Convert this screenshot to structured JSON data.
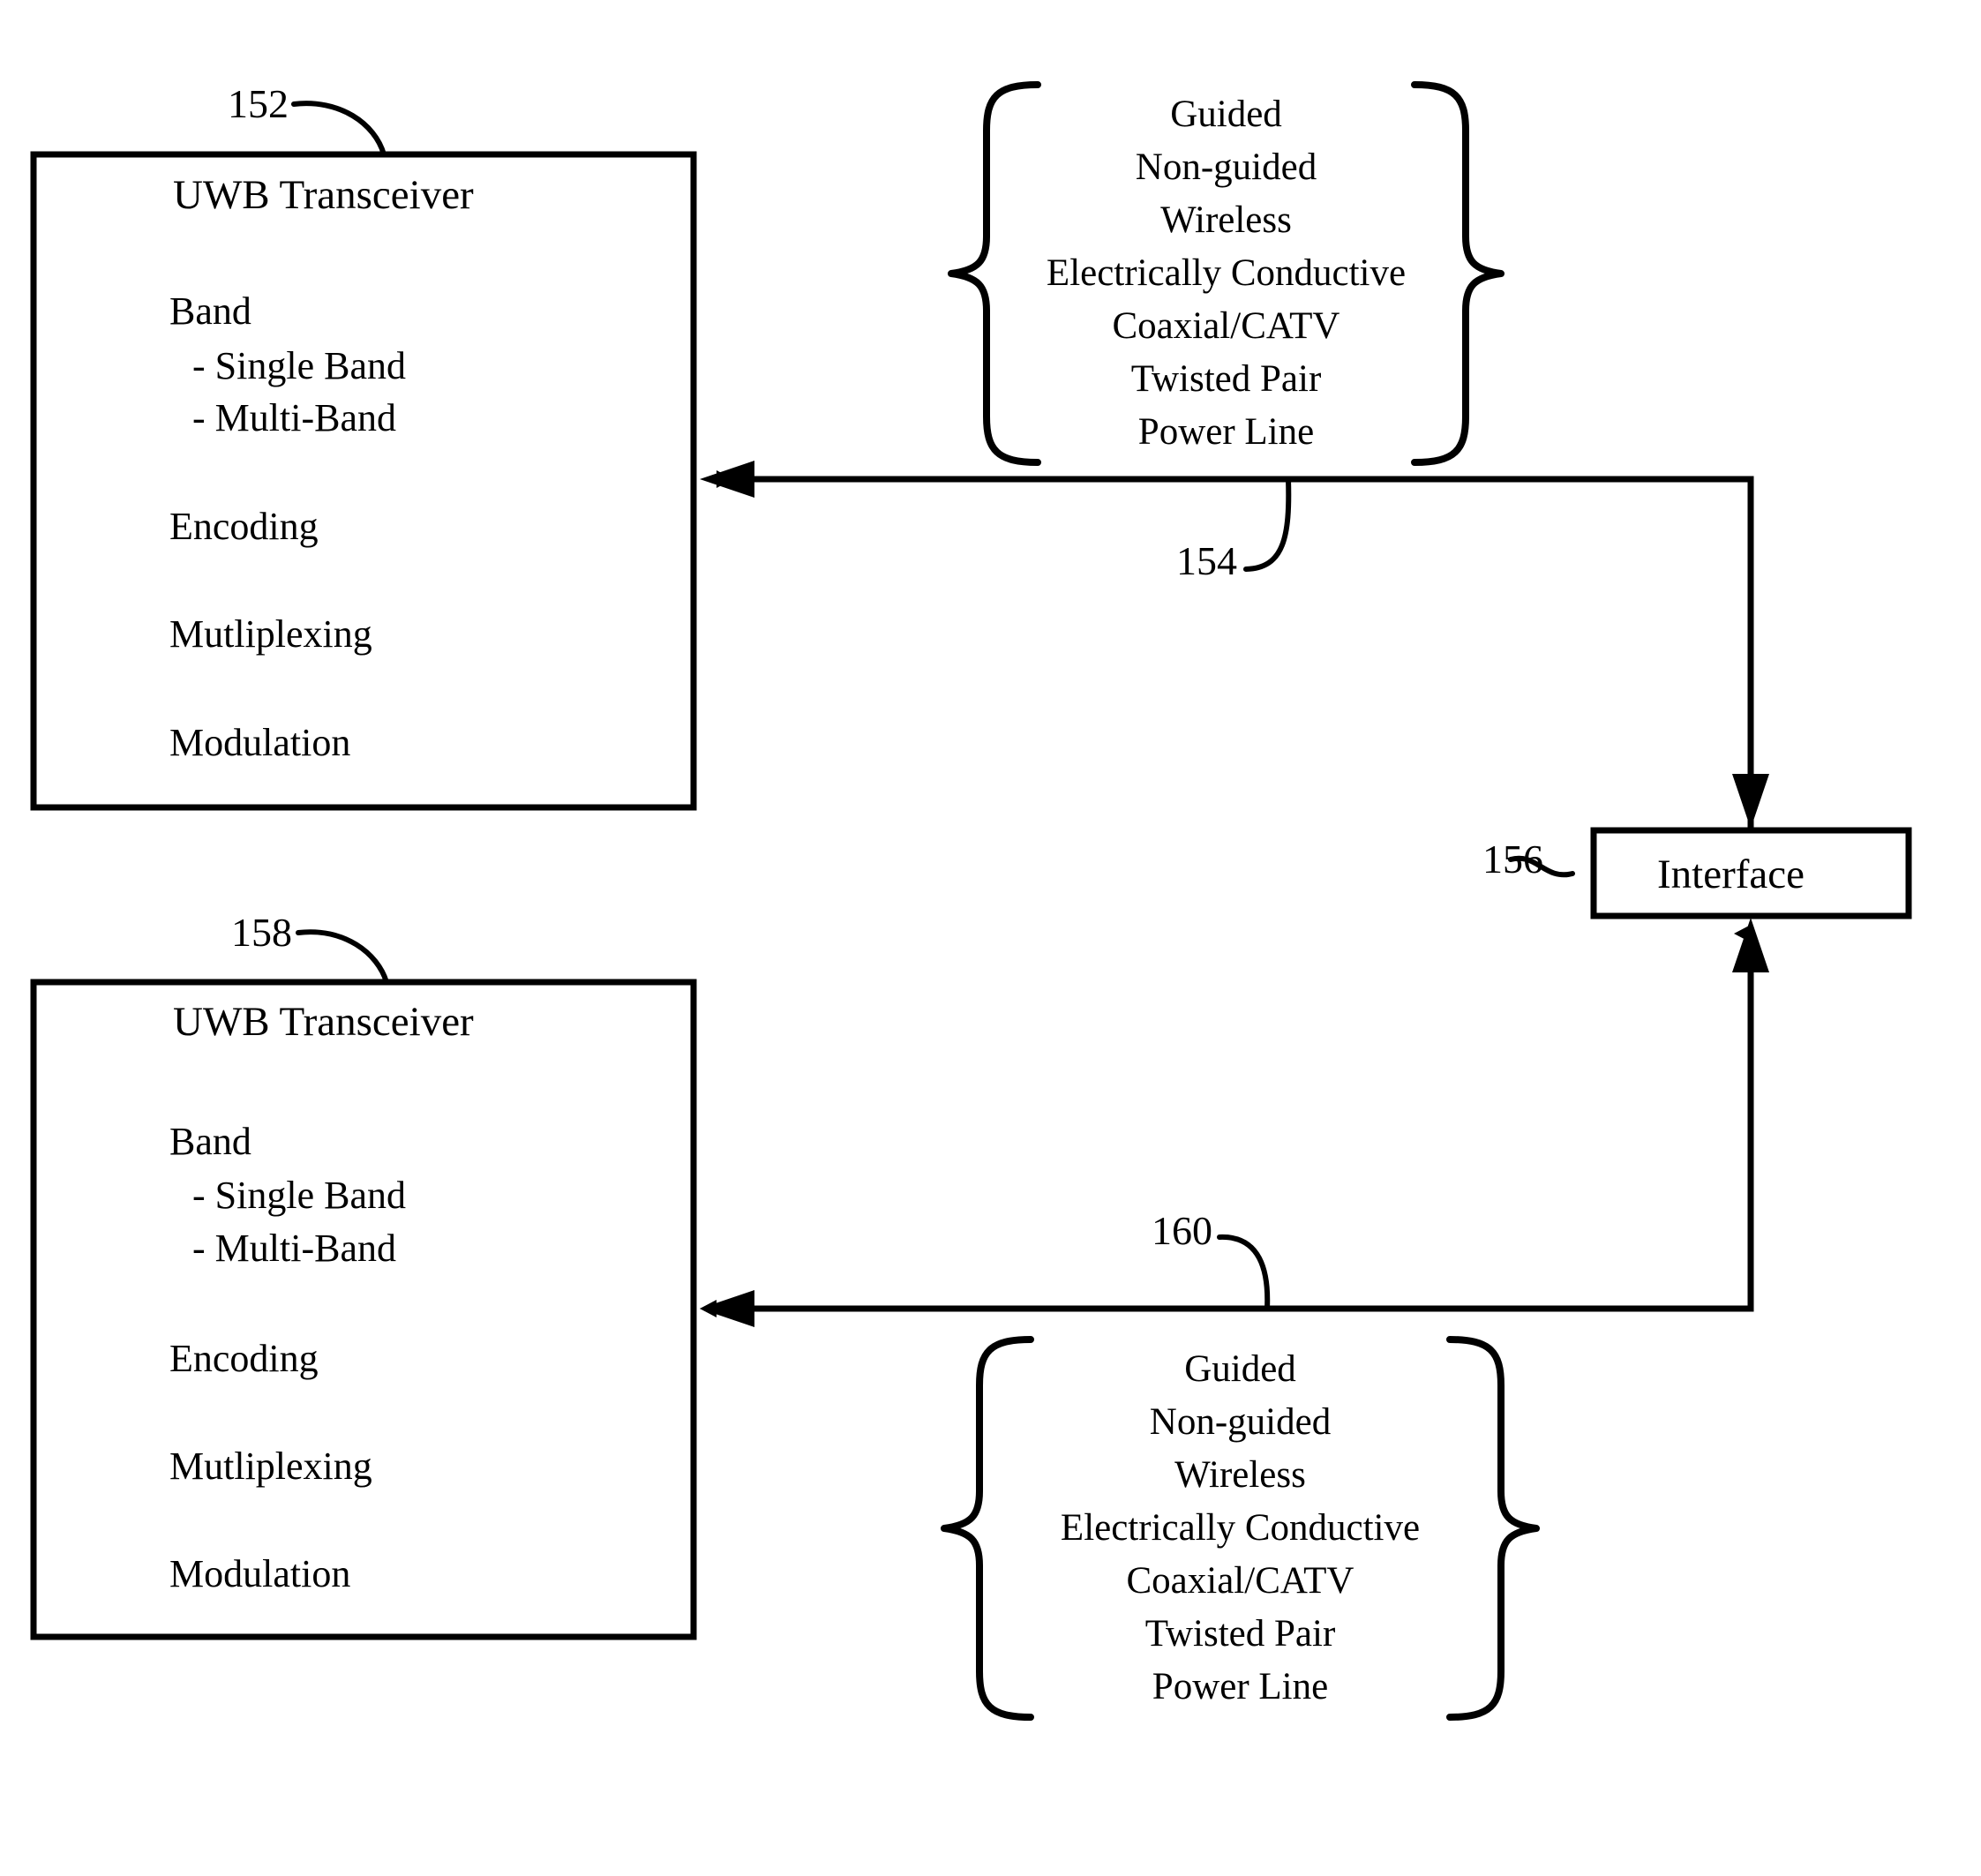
{
  "figure": {
    "background_color": "#ffffff",
    "stroke_color": "#000000"
  },
  "transceiver_top": {
    "ref": "152",
    "title": "UWB Transceiver",
    "items": [
      {
        "label": "Band",
        "subitems": [
          "- Single Band",
          "- Multi-Band"
        ]
      },
      {
        "label": "Encoding",
        "subitems": []
      },
      {
        "label": "Mutliplexing",
        "subitems": []
      },
      {
        "label": "Modulation",
        "subitems": []
      }
    ]
  },
  "transceiver_bottom": {
    "ref": "158",
    "title": "UWB Transceiver",
    "items": [
      {
        "label": "Band",
        "subitems": [
          "- Single Band",
          "- Multi-Band"
        ]
      },
      {
        "label": "Encoding",
        "subitems": []
      },
      {
        "label": "Mutliplexing",
        "subitems": []
      },
      {
        "label": "Modulation",
        "subitems": []
      }
    ]
  },
  "interface": {
    "ref": "156",
    "label": "Interface"
  },
  "link_top": {
    "ref": "154",
    "media_types": [
      "Guided",
      "Non-guided",
      "Wireless",
      "Electrically Conductive",
      "Coaxial/CATV",
      "Twisted Pair",
      "Power Line"
    ]
  },
  "link_bottom": {
    "ref": "160",
    "media_types": [
      "Guided",
      "Non-guided",
      "Wireless",
      "Electrically Conductive",
      "Coaxial/CATV",
      "Twisted Pair",
      "Power Line"
    ]
  }
}
